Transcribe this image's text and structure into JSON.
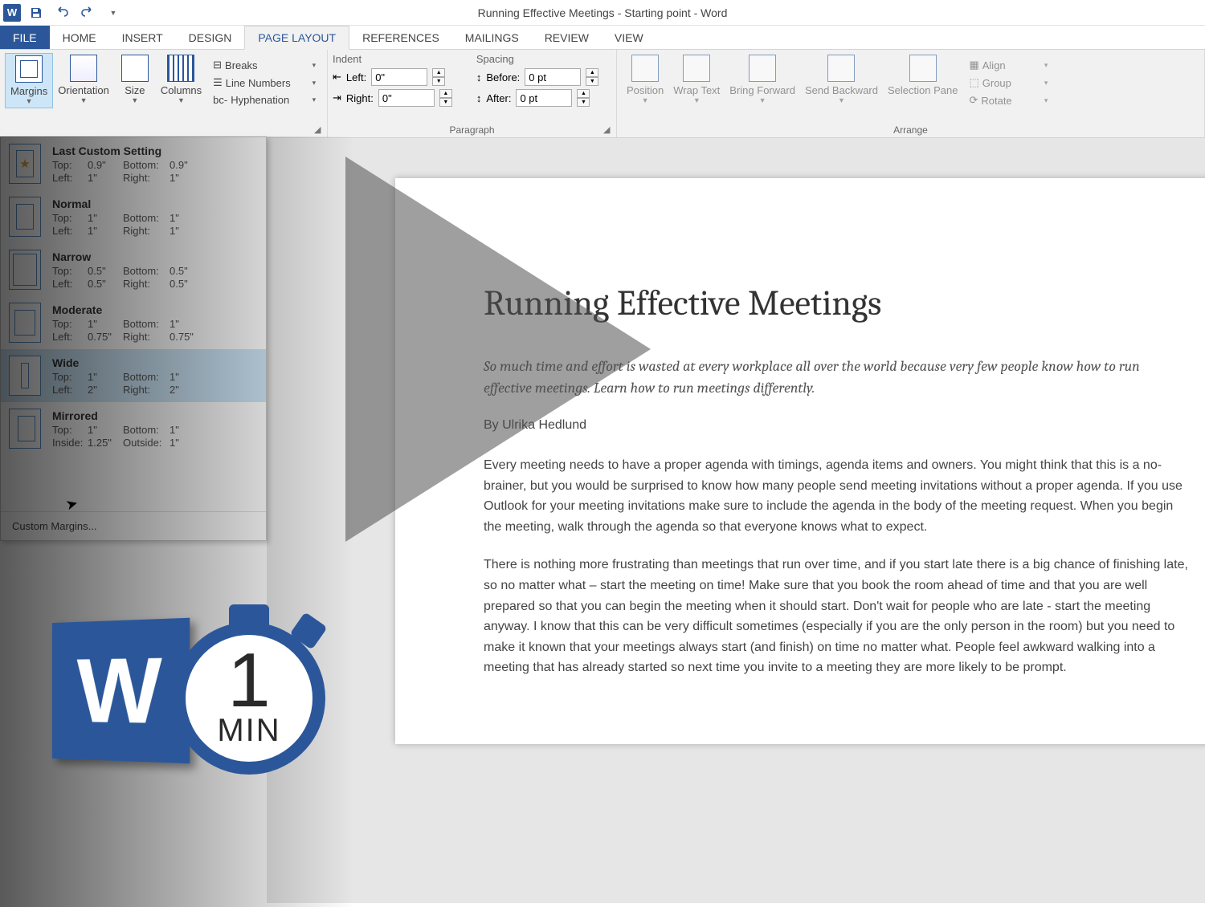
{
  "titlebar": {
    "title": "Running Effective Meetings - Starting point - Word"
  },
  "tabs": {
    "file": "FILE",
    "home": "HOME",
    "insert": "INSERT",
    "design": "DESIGN",
    "pagelayout": "PAGE LAYOUT",
    "references": "REFERENCES",
    "mailings": "MAILINGS",
    "review": "REVIEW",
    "view": "VIEW"
  },
  "ribbon": {
    "pagesetup": {
      "margins": "Margins",
      "orientation": "Orientation",
      "size": "Size",
      "columns": "Columns",
      "breaks": "Breaks",
      "linenumbers": "Line Numbers",
      "hyphenation": "Hyphenation"
    },
    "paragraph": {
      "label": "Paragraph",
      "indent_label": "Indent",
      "spacing_label": "Spacing",
      "left_label": "Left:",
      "left_value": "0\"",
      "right_label": "Right:",
      "right_value": "0\"",
      "before_label": "Before:",
      "before_value": "0 pt",
      "after_label": "After:",
      "after_value": "0 pt"
    },
    "arrange": {
      "label": "Arrange",
      "position": "Position",
      "wrap": "Wrap Text",
      "bringfwd": "Bring Forward",
      "sendback": "Send Backward",
      "selpane": "Selection Pane",
      "align": "Align",
      "group": "Group",
      "rotate": "Rotate"
    }
  },
  "margins_menu": {
    "last": {
      "title": "Last Custom Setting",
      "top": "0.9\"",
      "bottom": "0.9\"",
      "left": "1\"",
      "right": "1\""
    },
    "normal": {
      "title": "Normal",
      "top": "1\"",
      "bottom": "1\"",
      "left": "1\"",
      "right": "1\""
    },
    "narrow": {
      "title": "Narrow",
      "top": "0.5\"",
      "bottom": "0.5\"",
      "left": "0.5\"",
      "right": "0.5\""
    },
    "moderate": {
      "title": "Moderate",
      "top": "1\"",
      "bottom": "1\"",
      "left": "0.75\"",
      "right": "0.75\""
    },
    "wide": {
      "title": "Wide",
      "top": "1\"",
      "bottom": "1\"",
      "left": "2\"",
      "right": "2\""
    },
    "mirrored": {
      "title": "Mirrored",
      "top": "1\"",
      "bottom": "1\"",
      "left": "1.25\"",
      "right": "1\""
    },
    "labels": {
      "top": "Top:",
      "bottom": "Bottom:",
      "left": "Left:",
      "right": "Right:",
      "inside": "Inside:",
      "outside": "Outside:"
    },
    "custom": "Custom Margins..."
  },
  "document": {
    "title": "Running Effective Meetings",
    "subtitle": "So much time and effort is wasted at every workplace all over the world because very few people know how to run effective meetings. Learn how to run meetings differently.",
    "author": "By Ulrika Hedlund",
    "para1": "Every meeting needs to have a proper agenda with timings, agenda items and owners. You might think that this is a no-brainer, but you would be surprised to know how many people send meeting invitations without a proper agenda. If you use Outlook for your meeting invitations make sure to include the agenda in the body of the meeting request. When you begin the meeting, walk through the agenda so that everyone knows what to expect.",
    "para2": "There is nothing more frustrating than meetings that run over time, and if you start late there is a big chance of finishing late, so no matter what – start the meeting on time! Make sure that you book the room ahead of time and that you are well prepared so that you can begin the meeting when it should start. Don't wait for people who are late - start the meeting anyway. I know that this can be very difficult sometimes (especially if you are the only person in the room) but you need to make it known that your meetings always start (and finish) on time no matter what. People feel awkward walking into a meeting that has already started so next time you invite to a meeting they are more likely to be prompt."
  },
  "badge": {
    "one": "1",
    "min": "MIN",
    "w": "W"
  }
}
